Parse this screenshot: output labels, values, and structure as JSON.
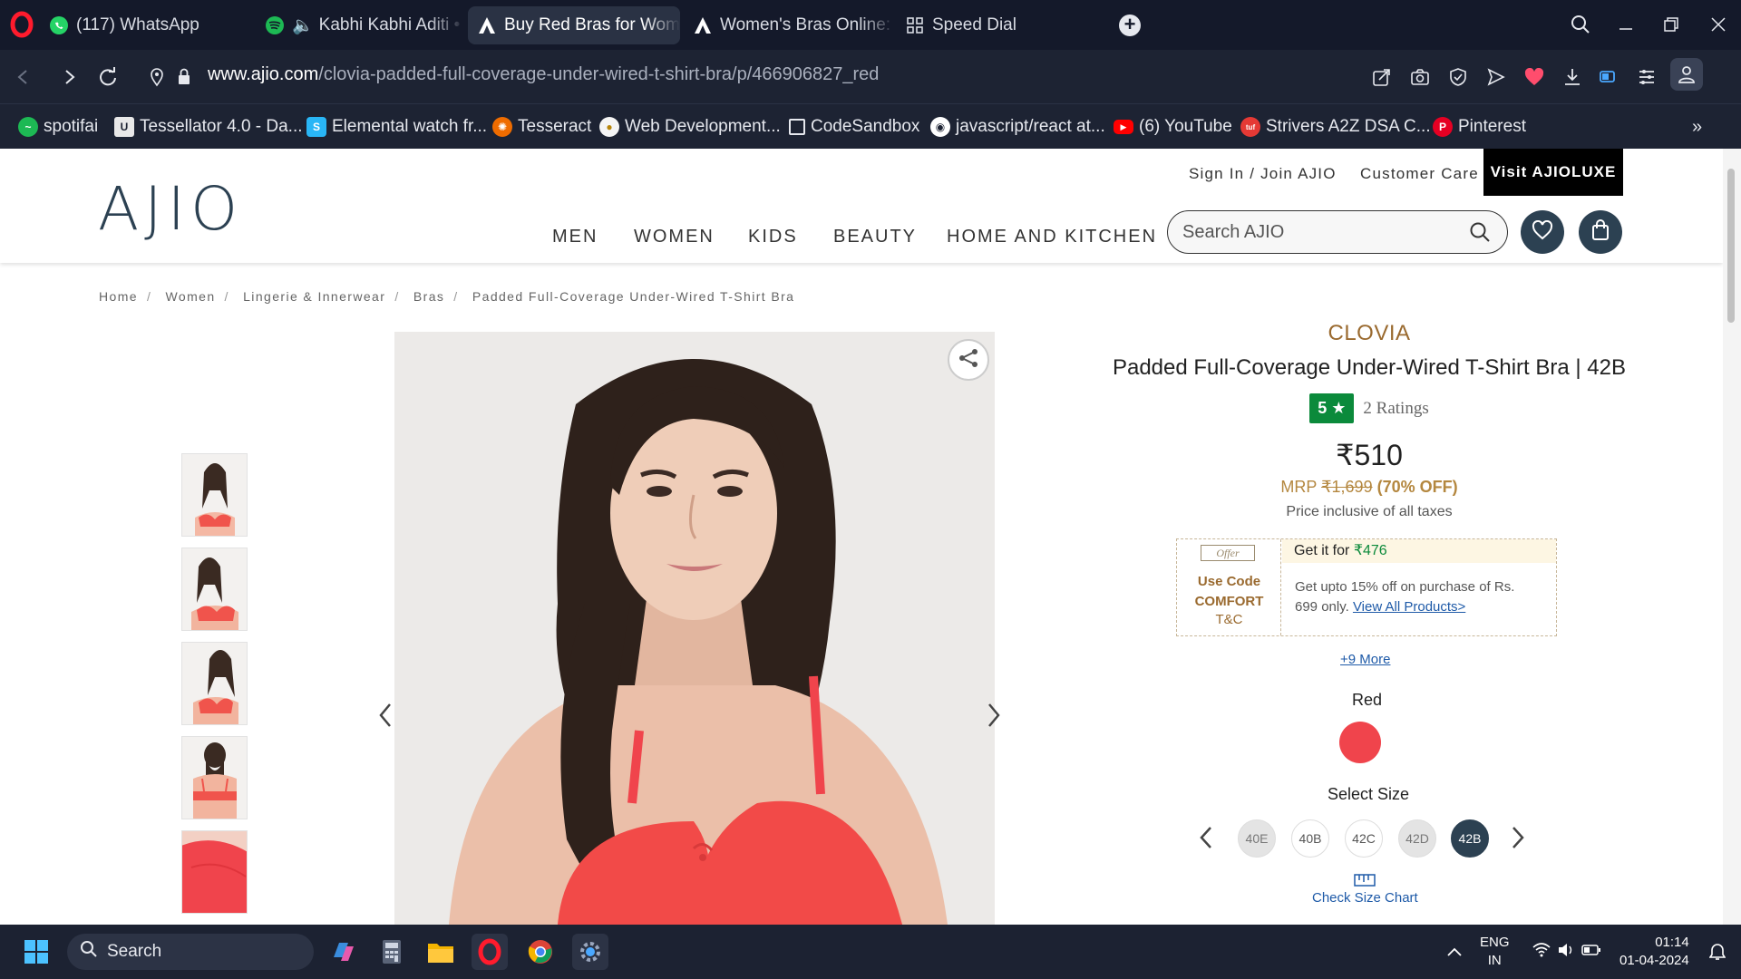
{
  "browser": {
    "tabs": [
      {
        "label": "(117) WhatsApp",
        "icon": "whatsapp-icon"
      },
      {
        "label": "Kabhi Kabhi Aditi • R",
        "icon": "spotify-icon"
      },
      {
        "label": "Buy Red Bras for Women",
        "icon": "ajio-icon",
        "active": true
      },
      {
        "label": "Women's Bras Online: Lo",
        "icon": "ajio-icon"
      },
      {
        "label": "Speed Dial",
        "icon": "speed-dial-icon"
      }
    ],
    "url_host": "www.ajio.com",
    "url_path": "/clovia-padded-full-coverage-under-wired-t-shirt-bra/p/466906827_red",
    "bookmarks": [
      {
        "label": "spotifai",
        "color": "#1db954"
      },
      {
        "label": "Tessellator 4.0 - Da...",
        "color": "#e8e8e8"
      },
      {
        "label": "Elemental watch fr...",
        "color": "#29b6f6"
      },
      {
        "label": "Tesseract",
        "color": "#ef6c00"
      },
      {
        "label": "Web Development...",
        "color": "#f5f5f5"
      },
      {
        "label": "CodeSandbox",
        "color": "#1d2333"
      },
      {
        "label": "javascript/react at...",
        "color": "#ffffff"
      },
      {
        "label": "(6) YouTube",
        "color": "#ff0000"
      },
      {
        "label": "Strivers A2Z DSA C...",
        "color": "#e53935"
      },
      {
        "label": "Pinterest",
        "color": "#e60023"
      }
    ]
  },
  "site": {
    "logo": "AJIO",
    "top_links": {
      "sign_in": "Sign In / Join AJIO",
      "customer_care": "Customer Care",
      "luxe": "Visit AJIOLUXE"
    },
    "nav": [
      "MEN",
      "WOMEN",
      "KIDS",
      "BEAUTY",
      "HOME AND KITCHEN"
    ],
    "search_placeholder": "Search AJIO",
    "breadcrumb": [
      "Home",
      "Women",
      "Lingerie & Innerwear",
      "Bras",
      "Padded Full-Coverage Under-Wired T-Shirt Bra"
    ]
  },
  "product": {
    "brand": "CLOVIA",
    "name": "Padded Full-Coverage Under-Wired T-Shirt Bra | 42B",
    "rating": "5 ★",
    "ratings_count": "2 Ratings",
    "price": "₹510",
    "mrp_label": "MRP",
    "mrp": "₹1,699",
    "discount": "(70% OFF)",
    "tax_note": "Price inclusive of all taxes",
    "offer": {
      "tag": "Offer",
      "use_code": "Use Code",
      "code": "COMFORT",
      "tc": "T&C",
      "get_it_prefix": "Get it for",
      "get_it_price": "₹476",
      "description": "Get upto 15% off on purchase of Rs. 699 only.",
      "link": "View All Products>"
    },
    "more_offers": "+9 More",
    "color_name": "Red",
    "color_hex": "#f0444c",
    "size_label": "Select Size",
    "sizes": [
      {
        "label": "40E",
        "state": "oos"
      },
      {
        "label": "40B",
        "state": "available"
      },
      {
        "label": "42C",
        "state": "available"
      },
      {
        "label": "42D",
        "state": "oos"
      },
      {
        "label": "42B",
        "state": "selected"
      }
    ],
    "size_chart": "Check Size Chart"
  },
  "taskbar": {
    "search": "Search",
    "lang": "ENG",
    "region": "IN",
    "time": "01:14",
    "date": "01-04-2024"
  }
}
